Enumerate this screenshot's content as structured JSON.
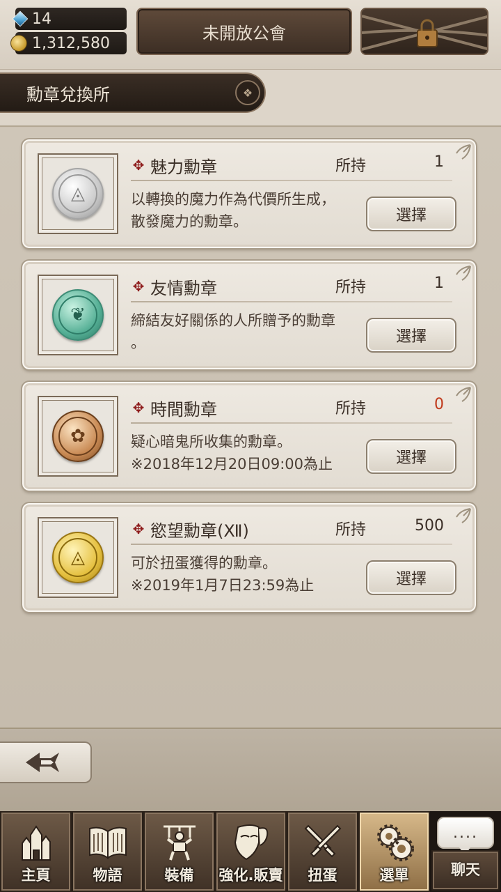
{
  "top": {
    "gems": "14",
    "gold": "1,312,580",
    "guild_button": "未開放公會",
    "gem_icon": "crystal-icon",
    "gold_icon": "coins-icon",
    "lock_icon": "padlock-chains-icon"
  },
  "page": {
    "title": "勳章兌換所"
  },
  "own_label": "所持",
  "select_label": "選擇",
  "medals": [
    {
      "name": "魅力勳章",
      "owned": "1",
      "desc_line1": "以轉換的魔力作為代價所生成，",
      "desc_line2": "散發魔力的勳章。",
      "icon": "silver-eye-medal-icon",
      "color": "#b5b5b5"
    },
    {
      "name": "友情勳章",
      "owned": "1",
      "desc_line1": "締結友好關係的人所贈予的勳章",
      "desc_line2": "。",
      "icon": "green-friendship-medal-icon",
      "color": "#4f9f88"
    },
    {
      "name": "時間勳章",
      "owned": "0",
      "desc_line1": "疑心暗鬼所收集的勳章。",
      "desc_line2": "※2018年12月20日09:00為止",
      "icon": "bronze-clock-medal-icon",
      "color": "#b57a47",
      "owned_color": "#c0391b"
    },
    {
      "name": "慾望勳章(Ⅻ)",
      "owned": "500",
      "desc_line1": "可於扭蛋獲得的勳章。",
      "desc_line2": "※2019年1月7日23:59為止",
      "icon": "gold-eye-medal-icon",
      "color": "#d9b53a"
    }
  ],
  "back_icon": "back-arrow-icon",
  "nav": [
    {
      "label": "主頁",
      "icon": "castle-icon",
      "active": false
    },
    {
      "label": "物語",
      "icon": "book-icon",
      "active": false
    },
    {
      "label": "裝備",
      "icon": "puppet-icon",
      "active": false
    },
    {
      "label": "強化.販賣",
      "icon": "shield-mask-icon",
      "active": false
    },
    {
      "label": "扭蛋",
      "icon": "crossed-swords-icon",
      "active": false
    },
    {
      "label": "選單",
      "icon": "gears-icon",
      "active": true
    }
  ],
  "chat": {
    "bubble": "....",
    "label": "聊天",
    "icon": "chat-bubble-icon"
  }
}
